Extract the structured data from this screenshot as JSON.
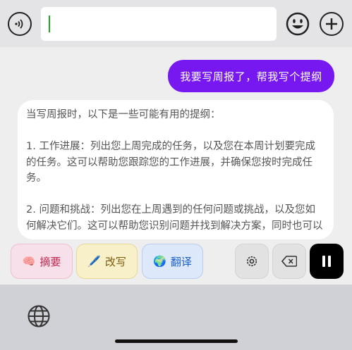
{
  "input": {
    "value": ""
  },
  "chat": {
    "user_message": "我要写周报了，帮我写个提纲",
    "assistant_message": "当写周报时，以下是一些可能有用的提纲：\n\n1. 工作进展：列出您上周完成的任务，以及您在本周计划要完成的任务。这可以帮助您跟踪您的工作进展，并确保您按时完成任务。\n\n2. 问题和挑战：列出您在上周遇到的任何问题或挑战，以及您如何解决它们。这可以帮助您识别问题并找到解决方案，同时也可以"
  },
  "actions": {
    "summary": {
      "emoji": "🧠",
      "label": "摘要"
    },
    "rewrite": {
      "emoji": "🖊️",
      "label": "改写"
    },
    "translate": {
      "emoji": "🌍",
      "label": "翻译"
    }
  },
  "colors": {
    "user_bubble": "#7818f0",
    "summary_text": "#c0264f",
    "rewrite_text": "#7a5b10",
    "translate_text": "#1e62c8"
  }
}
